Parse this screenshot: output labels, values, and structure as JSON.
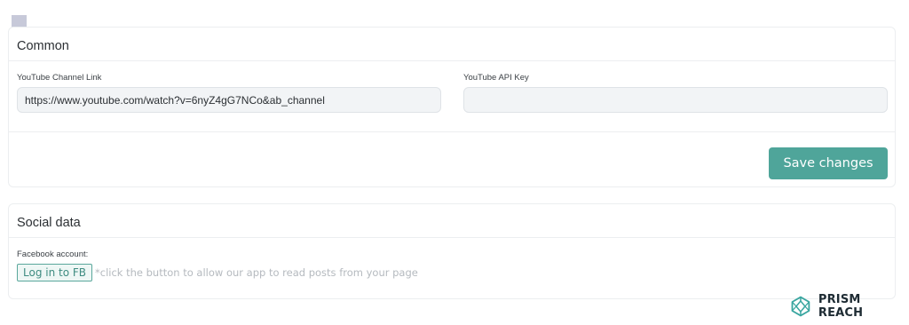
{
  "icons": {
    "bookmark": "bookmark-icon",
    "brand_logo": "prism-logo-icon"
  },
  "colors": {
    "accent": "#4fa59a",
    "bookmark": "#c7c9d9",
    "hint_text": "#b5babf"
  },
  "common": {
    "title": "Common",
    "youtube_link_label": "YouTube Channel Link",
    "youtube_link_value": "https://www.youtube.com/watch?v=6nyZ4gG7NCo&ab_channel",
    "api_key_label": "YouTube API Key",
    "api_key_value": "",
    "save_label": "Save changes"
  },
  "social": {
    "title": "Social data",
    "facebook_label": "Facebook account:",
    "login_label": "Log in to FB",
    "login_hint": "*click the button to allow our app to read posts from your page"
  },
  "brand": {
    "name": "PRISM REACH"
  }
}
